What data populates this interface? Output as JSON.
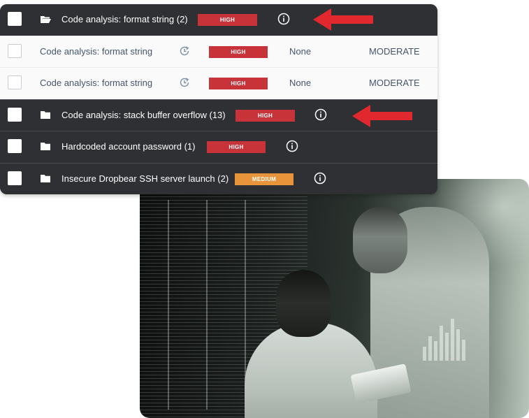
{
  "issues": [
    {
      "title": "Code analysis: format string (2)",
      "severity": "HIGH",
      "folder_icon": "folder-open-icon",
      "info_icon": "info-icon"
    },
    {
      "title": "Code analysis: format string",
      "severity": "HIGH",
      "status": "None",
      "rating": "MODERATE",
      "history_icon": "history-icon"
    },
    {
      "title": "Code analysis: format string",
      "severity": "HIGH",
      "status": "None",
      "rating": "MODERATE",
      "history_icon": "history-icon"
    },
    {
      "title": "Code analysis: stack buffer overflow (13)",
      "severity": "HIGH",
      "folder_icon": "folder-icon",
      "info_icon": "info-icon"
    },
    {
      "title": "Hardcoded account password (1)",
      "severity": "HIGH",
      "folder_icon": "folder-icon",
      "info_icon": "info-icon"
    },
    {
      "title": "Insecure Dropbear SSH server launch (2)",
      "severity": "MEDIUM",
      "folder_icon": "folder-icon",
      "info_icon": "info-icon"
    }
  ],
  "colors": {
    "panel_dark": "#2f3034",
    "row_light": "#fafafa",
    "high": "#c8333a",
    "medium": "#e8943a",
    "arrow": "#e0282e"
  }
}
